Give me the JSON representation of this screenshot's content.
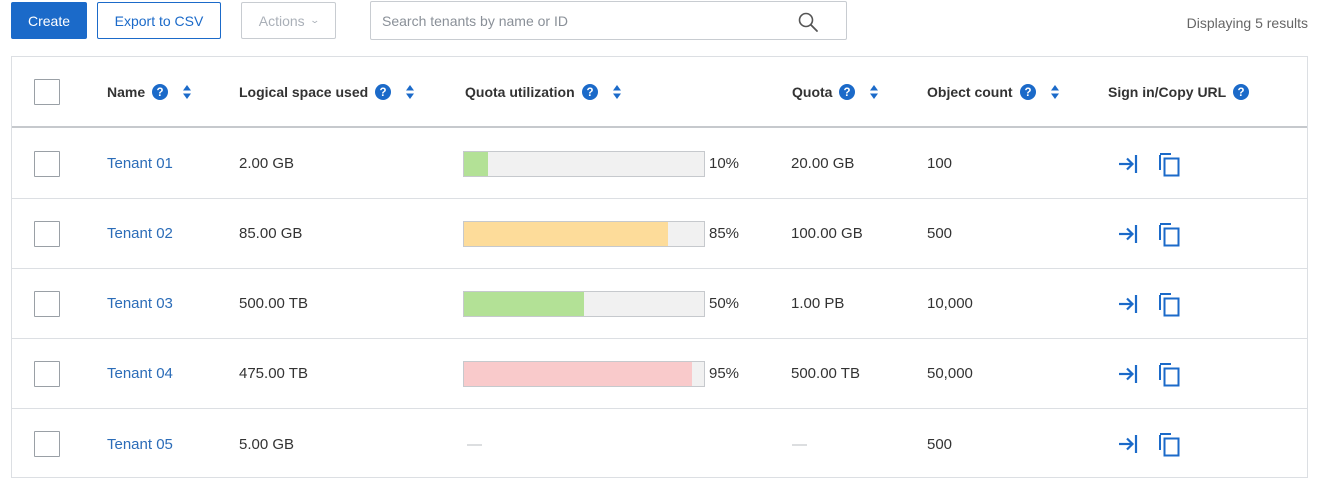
{
  "toolbar": {
    "create_label": "Create",
    "export_label": "Export to CSV",
    "actions_label": "Actions",
    "search_placeholder": "Search tenants by name or ID",
    "search_value": "",
    "results_text": "Displaying 5 results"
  },
  "table": {
    "columns": {
      "name": "Name",
      "logical_space": "Logical space used",
      "quota_utilization": "Quota utilization",
      "quota": "Quota",
      "object_count": "Object count",
      "sign_in": "Sign in/Copy URL"
    },
    "rows": [
      {
        "name": "Tenant 01",
        "logical_space": "2.00 GB",
        "utilization_label": "10%",
        "utilization": 10,
        "bar_color": "#b3e196",
        "quota": "20.00 GB",
        "object_count": "100"
      },
      {
        "name": "Tenant 02",
        "logical_space": "85.00 GB",
        "utilization_label": "85%",
        "utilization": 85,
        "bar_color": "#fddc9a",
        "quota": "100.00 GB",
        "object_count": "500"
      },
      {
        "name": "Tenant 03",
        "logical_space": "500.00 TB",
        "utilization_label": "50%",
        "utilization": 50,
        "bar_color": "#b3e196",
        "quota": "1.00 PB",
        "object_count": "10,000"
      },
      {
        "name": "Tenant 04",
        "logical_space": "475.00 TB",
        "utilization_label": "95%",
        "utilization": 95,
        "bar_color": "#f9cacb",
        "quota": "500.00 TB",
        "object_count": "50,000"
      },
      {
        "name": "Tenant 05",
        "logical_space": "5.00 GB",
        "utilization_label": "—",
        "utilization": null,
        "bar_color": "",
        "quota": "—",
        "object_count": "500"
      }
    ]
  },
  "colors": {
    "accent": "#1b6ac9",
    "link": "#2b6cb8",
    "help_icon": "#1b6ac9"
  },
  "icons": {
    "search": "search-icon",
    "help": "question-circle-icon",
    "sort": "sort-icon",
    "sign_in": "sign-in-icon",
    "copy": "copy-icon"
  }
}
